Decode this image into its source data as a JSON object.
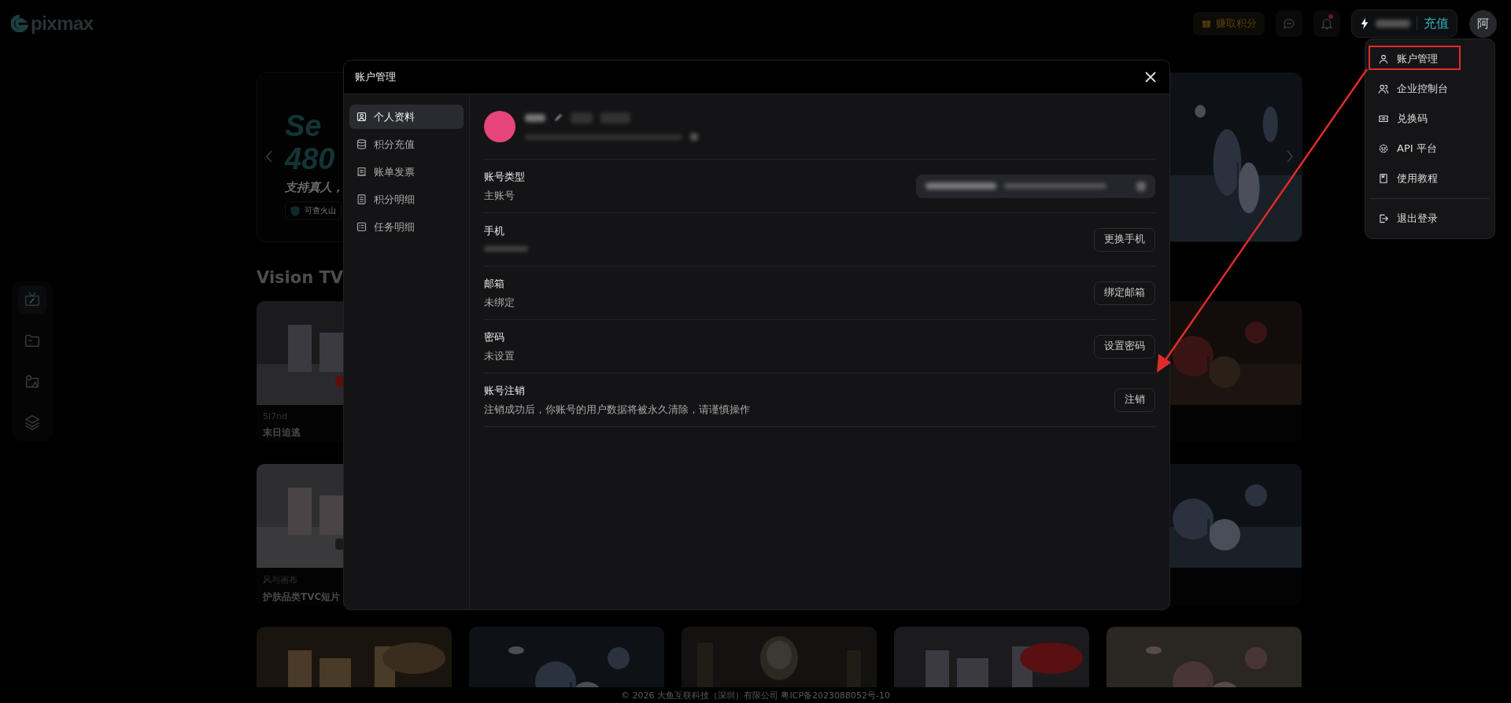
{
  "header": {
    "logo": "pixmax",
    "earn_button": "赚取积分",
    "recharge": "充值",
    "avatar": "阿"
  },
  "rail": [
    {
      "selected": true
    },
    {
      "selected": false
    },
    {
      "selected": false
    },
    {
      "selected": false
    }
  ],
  "banner": {
    "title_lines": [
      "Se",
      "480"
    ],
    "subtitle": "支持真人，",
    "badge": "可查火山"
  },
  "section_title": "Vision TV",
  "card_rows": [
    {
      "cards": [
        {
          "kind": "captioned",
          "category": "5I7nd",
          "title": "末日追逃"
        },
        {
          "kind": "picture"
        }
      ]
    },
    {
      "cards": [
        {
          "kind": "captioned",
          "category": "风与画布",
          "title": "护肤品类TVC短片"
        },
        {
          "kind": "picture"
        }
      ]
    },
    {
      "cards": [
        {
          "kind": "picture"
        },
        {
          "kind": "picture"
        },
        {
          "kind": "picture"
        },
        {
          "kind": "picture"
        },
        {
          "kind": "picture"
        }
      ]
    }
  ],
  "footer": "© 2026 大鱼互联科技（深圳）有限公司 粤ICP备2023088052号-10",
  "modal": {
    "title": "账户管理",
    "nav": [
      {
        "label": "个人资料",
        "selected": true
      },
      {
        "label": "积分充值",
        "selected": false
      },
      {
        "label": "账单发票",
        "selected": false
      },
      {
        "label": "积分明细",
        "selected": false
      },
      {
        "label": "任务明细",
        "selected": false
      }
    ],
    "rows": [
      {
        "kind": "link",
        "label": "账号类型",
        "value": "主账号"
      },
      {
        "kind": "button",
        "label": "手机",
        "button": "更换手机"
      },
      {
        "kind": "button",
        "label": "邮箱",
        "value": "未绑定",
        "button": "绑定邮箱"
      },
      {
        "kind": "button",
        "label": "密码",
        "value": "未设置",
        "button": "设置密码"
      },
      {
        "kind": "button",
        "label": "账号注销",
        "value": "注销成功后，你账号的用户数据将被永久清除，请谨慎操作",
        "button": "注销"
      }
    ]
  },
  "user_menu": {
    "items": [
      {
        "label": "账户管理",
        "annotated": true
      },
      {
        "label": "企业控制台",
        "annotated": false
      },
      {
        "label": "兑换码",
        "annotated": false
      },
      {
        "label": "API 平台",
        "annotated": false
      },
      {
        "label": "使用教程",
        "annotated": false
      }
    ],
    "bottom_items": [
      {
        "label": "退出登录",
        "annotated": false
      }
    ]
  }
}
